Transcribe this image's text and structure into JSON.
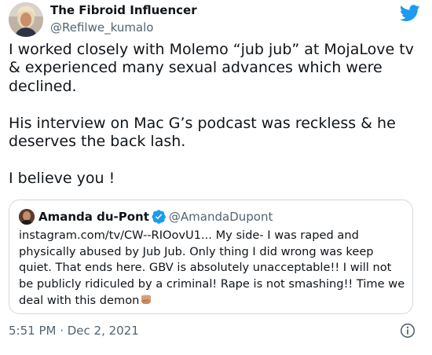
{
  "tweet": {
    "author": {
      "display_name": "The Fibroid Influencer",
      "handle": "@Refilwe_kumalo"
    },
    "text": "I worked closely with Molemo “jub jub” at MojaLove tv & experienced many sexual advances which were declined.\n\nHis interview on Mac G’s podcast was reckless & he deserves the back lash.\n\nI believe you !",
    "quoted_tweet": {
      "display_name": "Amanda du-Pont",
      "handle": "@AmandaDupont",
      "text": "instagram.com/tv/CW--RIOovU1... My side- I was raped and physically abused by Jub Jub. Only thing I did wrong was keep quiet. That ends here. GBV is absolutely unacceptable!! I will not be publicly ridiculed by a criminal! Rape is not smashing!! Time we deal with this demon",
      "emoji_icon": "raised-fist-medium-skin-tone-icon",
      "verified_icon": "verified-badge-icon"
    },
    "timestamp": "5:51 PM · Dec 2, 2021",
    "icons": {
      "brand": "twitter-bird-icon",
      "info": "info-icon"
    }
  },
  "colors": {
    "text_primary": "#0f1419",
    "text_secondary": "#536471",
    "twitter_blue": "#1d9bf0",
    "border": "#cfd9de"
  }
}
